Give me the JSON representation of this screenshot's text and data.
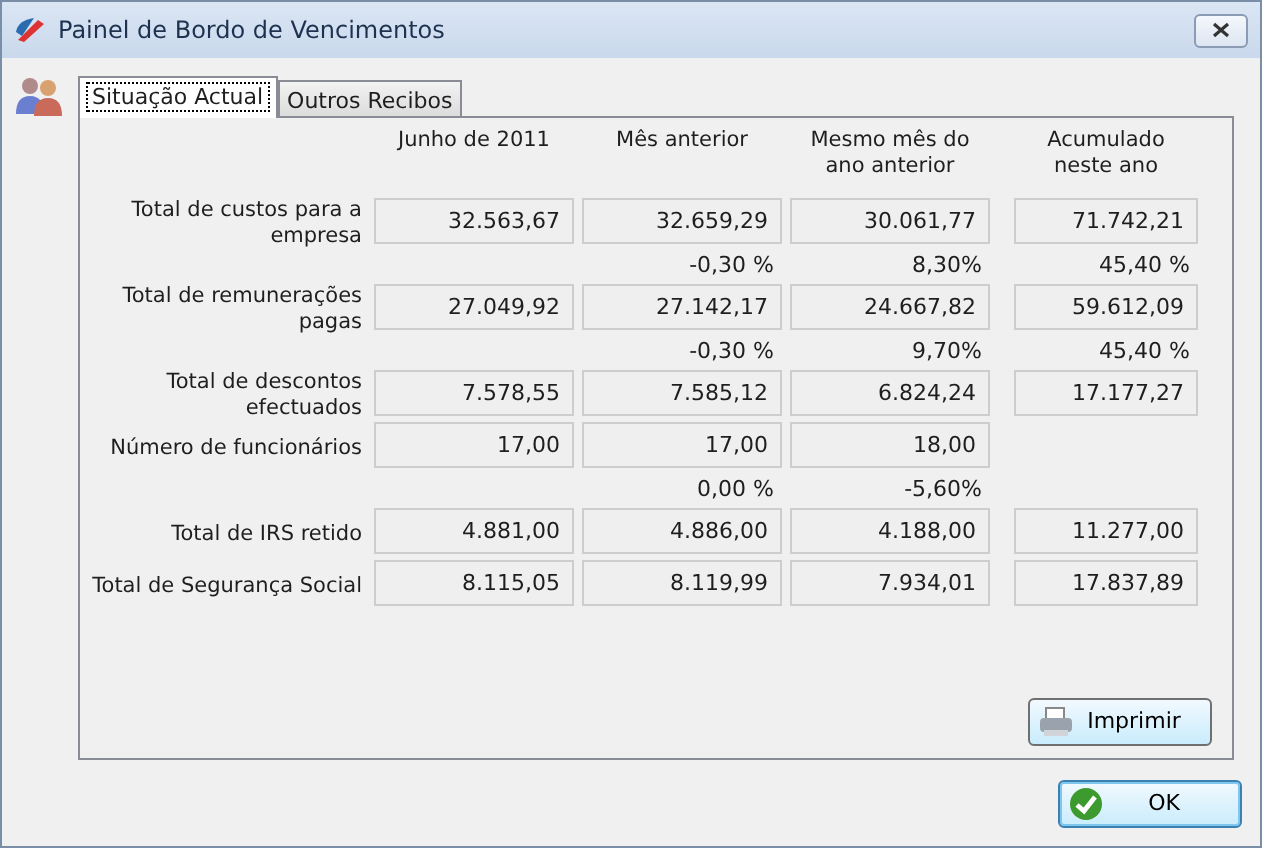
{
  "window": {
    "title": "Painel de Bordo de Vencimentos"
  },
  "tabs": [
    {
      "label": "Situação Actual",
      "selected": true
    },
    {
      "label": "Outros Recibos",
      "selected": false
    }
  ],
  "columns": [
    "Junho de 2011",
    "Mês anterior",
    "Mesmo mês do ano anterior",
    "Acumulado neste ano"
  ],
  "rows": [
    {
      "kind": "values",
      "label": "Total de custos para a empresa",
      "cells": [
        "32.563,67",
        "32.659,29",
        "30.061,77",
        "71.742,21"
      ]
    },
    {
      "kind": "change",
      "cells": [
        "-0,30 %",
        "8,30%",
        "45,40 %"
      ]
    },
    {
      "kind": "values",
      "label": "Total de remunerações pagas",
      "cells": [
        "27.049,92",
        "27.142,17",
        "24.667,82",
        "59.612,09"
      ]
    },
    {
      "kind": "change",
      "cells": [
        "-0,30 %",
        "9,70%",
        "45,40 %"
      ]
    },
    {
      "kind": "values",
      "label": "Total de descontos efectuados",
      "cells": [
        "7.578,55",
        "7.585,12",
        "6.824,24",
        "17.177,27"
      ]
    },
    {
      "kind": "values",
      "label": "Número de funcionários",
      "cells": [
        "17,00",
        "17,00",
        "18,00"
      ]
    },
    {
      "kind": "change",
      "cells": [
        "0,00 %",
        "-5,60%"
      ]
    },
    {
      "kind": "values",
      "label": "Total de IRS retido",
      "cells": [
        "4.881,00",
        "4.886,00",
        "4.188,00",
        "11.277,00"
      ]
    },
    {
      "kind": "values",
      "label": "Total de Segurança Social",
      "cells": [
        "8.115,05",
        "8.119,99",
        "7.934,01",
        "17.837,89"
      ]
    }
  ],
  "buttons": [
    {
      "kind": "print",
      "label": "Imprimir"
    },
    {
      "kind": "ok",
      "label": "OK"
    }
  ]
}
